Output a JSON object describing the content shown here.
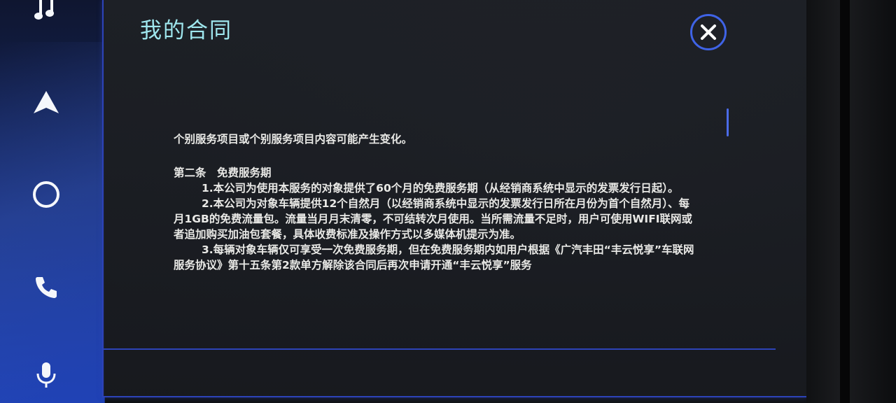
{
  "page": {
    "title": "我的合同"
  },
  "nav": {
    "items": [
      {
        "icon": "music-note-icon"
      },
      {
        "icon": "navigation-arrow-icon"
      },
      {
        "icon": "home-circle-icon"
      },
      {
        "icon": "phone-icon"
      },
      {
        "icon": "microphone-icon"
      }
    ]
  },
  "contract": {
    "line_intro": "个别服务项目或个别服务项目内容可能产生变化。",
    "section_heading": "第二条　免费服务期",
    "clause_1": "1.本公司为使用本服务的对象提供了60个月的免费服务期（从经销商系统中显示的发票发行日起）。",
    "clause_2": "2.本公司为对象车辆提供12个自然月（以经销商系统中显示的发票发行日所在月份为首个自然月）、每月1GB的免费流量包。流量当月月末清零，不可结转次月使用。当所需流量不足时，用户可使用WIFI联网或者追加购买加油包套餐，具体收费标准及操作方式以多媒体机提示为准。",
    "clause_3": "3.每辆对象车辆仅可享受一次免费服务期，但在免费服务期内如用户根据《广汽丰田“丰云悦享”车联网服务协议》第十五条第2款单方解除该合同后再次申请开通“丰云悦享”服务"
  },
  "colors": {
    "accent_blue": "#2d43b8",
    "title_cyan": "#9fe7ee",
    "text": "#e9e9e6"
  }
}
